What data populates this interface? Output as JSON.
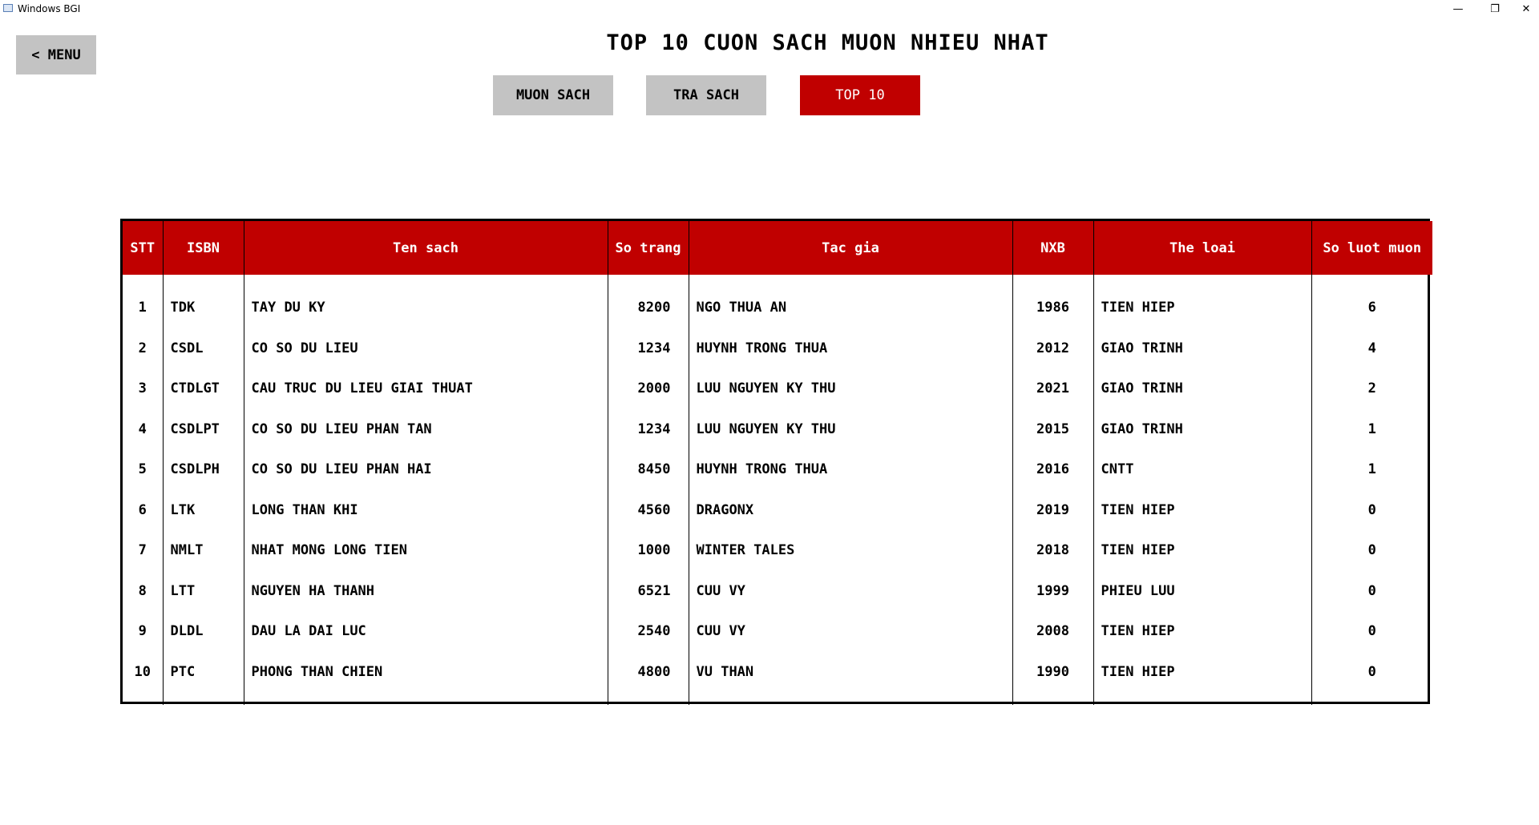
{
  "window": {
    "title": "Windows BGI",
    "minimize_glyph": "—",
    "maximize_glyph": "❐",
    "close_glyph": "✕"
  },
  "nav": {
    "menu_label": "< MENU"
  },
  "page_title": "TOP 10 CUON SACH MUON NHIEU NHAT",
  "tabs": [
    {
      "label": "MUON SACH",
      "active": false
    },
    {
      "label": "TRA SACH",
      "active": false
    },
    {
      "label": "TOP 10",
      "active": true
    }
  ],
  "colors": {
    "accent": "#c00000",
    "button_gray": "#c3c3c3"
  },
  "table": {
    "headers": [
      "STT",
      "ISBN",
      "Ten sach",
      "So trang",
      "Tac gia",
      "NXB",
      "The loai",
      "So luot muon"
    ],
    "rows": [
      [
        "1",
        "TDK",
        "TAY DU KY",
        "8200",
        "NGO THUA AN",
        "1986",
        "TIEN HIEP",
        "6"
      ],
      [
        "2",
        "CSDL",
        "CO SO DU LIEU",
        "1234",
        "HUYNH TRONG THUA",
        "2012",
        "GIAO TRINH",
        "4"
      ],
      [
        "3",
        "CTDLGT",
        "CAU TRUC DU LIEU GIAI THUAT",
        "2000",
        "LUU NGUYEN KY THU",
        "2021",
        "GIAO TRINH",
        "2"
      ],
      [
        "4",
        "CSDLPT",
        "CO SO DU LIEU PHAN TAN",
        "1234",
        "LUU NGUYEN KY THU",
        "2015",
        "GIAO TRINH",
        "1"
      ],
      [
        "5",
        "CSDLPH",
        "CO SO DU LIEU PHAN HAI",
        "8450",
        "HUYNH TRONG THUA",
        "2016",
        "CNTT",
        "1"
      ],
      [
        "6",
        "LTK",
        "LONG THAN KHI",
        "4560",
        "DRAGONX",
        "2019",
        "TIEN HIEP",
        "0"
      ],
      [
        "7",
        "NMLT",
        "NHAT MONG LONG TIEN",
        "1000",
        "WINTER TALES",
        "2018",
        "TIEN HIEP",
        "0"
      ],
      [
        "8",
        "LTT",
        "NGUYEN HA THANH",
        "6521",
        "CUU VY",
        "1999",
        "PHIEU LUU",
        "0"
      ],
      [
        "9",
        "DLDL",
        "DAU LA DAI LUC",
        "2540",
        "CUU VY",
        "2008",
        "TIEN HIEP",
        "0"
      ],
      [
        "10",
        "PTC",
        "PHONG THAN CHIEN",
        "4800",
        "VU THAN",
        "1990",
        "TIEN HIEP",
        "0"
      ]
    ]
  }
}
